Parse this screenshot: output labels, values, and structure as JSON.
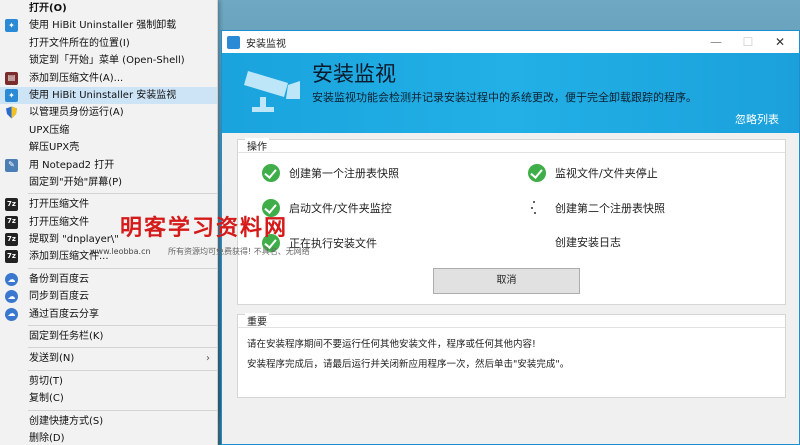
{
  "context_menu": {
    "items": [
      {
        "label": "打开(O)",
        "icon": "none",
        "bold": true
      },
      {
        "label": "使用 HiBit Uninstaller 强制卸载",
        "icon": "hibit-icon"
      },
      {
        "label": "打开文件所在的位置(I)",
        "icon": "none"
      },
      {
        "label": "锁定到「开始」菜单 (Open-Shell)",
        "icon": "none"
      },
      {
        "label": "添加到压缩文件(A)...",
        "icon": "archive-icon"
      },
      {
        "label": "使用 HiBit Uninstaller 安装监视",
        "icon": "hibit-icon",
        "highlight": true
      },
      {
        "label": "以管理员身份运行(A)",
        "icon": "shield-icon"
      },
      {
        "label": "UPX压缩",
        "icon": "none"
      },
      {
        "label": "解压UPX壳",
        "icon": "none"
      },
      {
        "label": "用 Notepad2 打开",
        "icon": "notepad-icon"
      },
      {
        "label": "固定到\"开始\"屏幕(P)",
        "icon": "none"
      },
      {
        "label": "打开压缩文件",
        "icon": "7zip-icon"
      },
      {
        "label": "打开压缩文件",
        "icon": "7zip-icon"
      },
      {
        "label": "提取到 \"dnplayer\\\"",
        "icon": "7zip-icon"
      },
      {
        "label": "添加到压缩文件...",
        "icon": "7zip-icon"
      },
      {
        "label": "备份到百度云",
        "icon": "baidu-icon"
      },
      {
        "label": "同步到百度云",
        "icon": "baidu-icon"
      },
      {
        "label": "通过百度云分享",
        "icon": "baidu-icon"
      },
      {
        "label": "固定到任务栏(K)",
        "icon": "none"
      },
      {
        "label": "发送到(N)",
        "icon": "none",
        "submenu": true
      },
      {
        "label": "剪切(T)",
        "icon": "none"
      },
      {
        "label": "复制(C)",
        "icon": "none"
      },
      {
        "label": "创建快捷方式(S)",
        "icon": "none"
      },
      {
        "label": "删除(D)",
        "icon": "none"
      }
    ],
    "submenu_arrow": "›"
  },
  "window": {
    "title": "安装监视",
    "controls": {
      "minimize": "—",
      "maximize": "☐",
      "close": "✕"
    },
    "banner": {
      "title": "安装监视",
      "description": "安装监视功能会检测并记录安装过程中的系统更改，便于完全卸载跟踪的程序。",
      "link": "忽略列表"
    },
    "operations": {
      "label": "操作",
      "items": [
        {
          "text": "创建第一个注册表快照",
          "status": "done"
        },
        {
          "text": "监视文件/文件夹停止",
          "status": "done"
        },
        {
          "text": "启动文件/文件夹监控",
          "status": "done"
        },
        {
          "text": "创建第二个注册表快照",
          "status": "in-progress"
        },
        {
          "text": "正在执行安装文件",
          "status": "done"
        },
        {
          "text": "创建安装日志",
          "status": "pending"
        }
      ],
      "cancel_button": "取消"
    },
    "important": {
      "label": "重要",
      "lines": [
        "请在安装程序期间不要运行任何其他安装文件，程序或任何其他内容!",
        "安装程序完成后，请最后运行并关闭新应用程序一次，然后单击\"安装完成\"。"
      ]
    }
  },
  "watermark": {
    "title": "明客学习资料网",
    "url": "www.leobba.cn",
    "subtitle": "所有资源均可免费获得! 不具名、无网络"
  },
  "colors": {
    "accent": "#1aa3dd",
    "check_green": "#3fae49",
    "highlight": "#cde4f7",
    "watermark_red": "#d51a1a"
  }
}
